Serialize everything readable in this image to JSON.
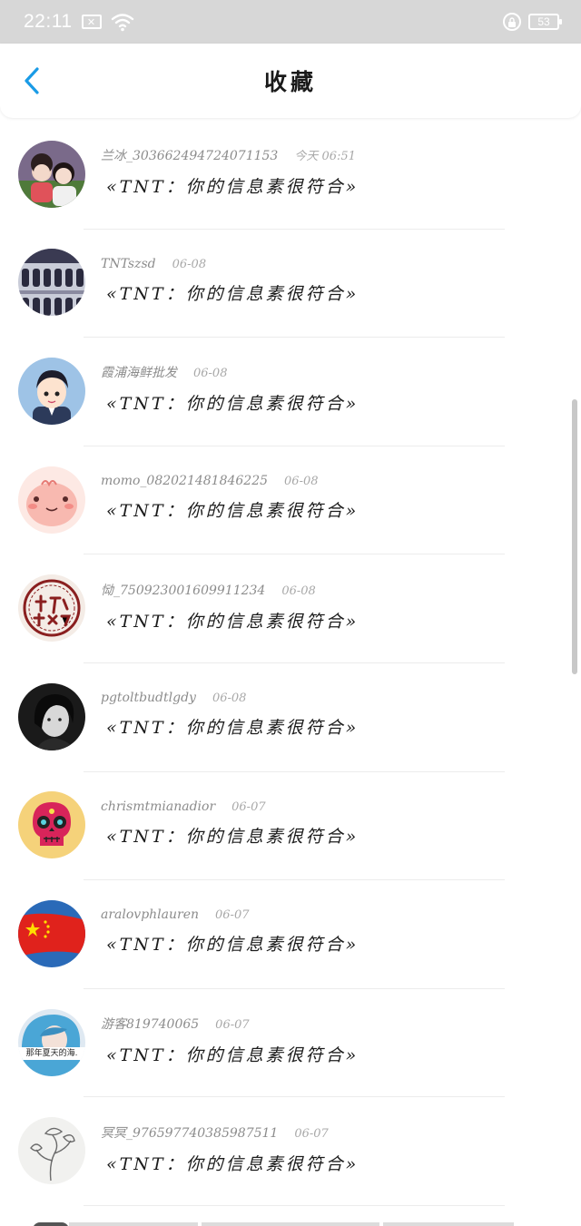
{
  "status_bar": {
    "time": "22:11",
    "battery": "53",
    "icons": [
      "notification-icon",
      "wifi-icon",
      "lock-icon",
      "battery-icon"
    ]
  },
  "header": {
    "title": "收藏",
    "back_icon": "chevron-left-icon",
    "accent_color": "#1a9be6"
  },
  "favorites": [
    {
      "user": "兰冰_303662494724071153",
      "time": "今天 06:51",
      "message": "«TNT：你的信息素很符合»",
      "avatar": "avatar-two-girls"
    },
    {
      "user": "TNTszsd",
      "time": "06-08",
      "message": "«TNT：你的信息素很符合»",
      "avatar": "avatar-group-photo"
    },
    {
      "user": "霞浦海鲜批发",
      "time": "06-08",
      "message": "«TNT：你的信息素很符合»",
      "avatar": "avatar-cartoon-boy"
    },
    {
      "user": "momo_082021481846225",
      "time": "06-08",
      "message": "«TNT：你的信息素很符合»",
      "avatar": "avatar-pink-character"
    },
    {
      "user": "恸_750923001609911234",
      "time": "06-08",
      "message": "«TNT：你的信息素很符合»",
      "avatar": "avatar-red-seal"
    },
    {
      "user": "pgtoltbudtlgdy",
      "time": "06-08",
      "message": "«TNT：你的信息素很符合»",
      "avatar": "avatar-bw-portrait"
    },
    {
      "user": "chrismtmianadior",
      "time": "06-07",
      "message": "«TNT：你的信息素很符合»",
      "avatar": "avatar-sugar-skull"
    },
    {
      "user": "aralovphlauren",
      "time": "06-07",
      "message": "«TNT：你的信息素很符合»",
      "avatar": "avatar-china-flag"
    },
    {
      "user": "游客819740065",
      "time": "06-07",
      "message": "«TNT：你的信息素很符合»",
      "avatar": "avatar-blue-hair",
      "avatar_caption": "那年夏天的海."
    },
    {
      "user": "冥冥_976597740385987511",
      "time": "06-07",
      "message": "«TNT：你的信息素很符合»",
      "avatar": "avatar-ink-sketch"
    }
  ]
}
